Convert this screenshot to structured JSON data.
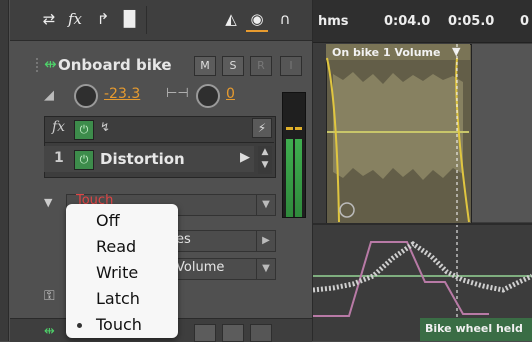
{
  "toolbar": {
    "icons": [
      "swap-icon",
      "fx-icon",
      "sends-icon",
      "eq-icon",
      "metronome-icon",
      "record-icon",
      "headphones-icon"
    ]
  },
  "track": {
    "name": "Onboard bike",
    "buttons": {
      "mute": "M",
      "solo": "S",
      "record": "R",
      "input": "I"
    },
    "volume": "-23.3",
    "pan": "0"
  },
  "fx_rack": {
    "effects": [
      {
        "number": "1",
        "name": "Distortion"
      }
    ]
  },
  "automation": {
    "mode_label": "Touch",
    "row1_suffix": "es",
    "row2_suffix": "Volume"
  },
  "automation_menu": {
    "items": [
      "Off",
      "Read",
      "Write",
      "Latch",
      "Touch"
    ],
    "selected": "Touch"
  },
  "timeline": {
    "ruler": {
      "unit": "hms",
      "mark1": "0:04.0",
      "mark2": "0:05.0",
      "mark3": "0"
    },
    "clip_label": "On bike 1 Volume",
    "bottom_clip_label": "Bike wheel held"
  },
  "colors": {
    "accent_orange": "#e79b2f",
    "mode_red": "#e04545",
    "power_green": "#3d8c4b",
    "meter_green": "#3fae4f"
  }
}
